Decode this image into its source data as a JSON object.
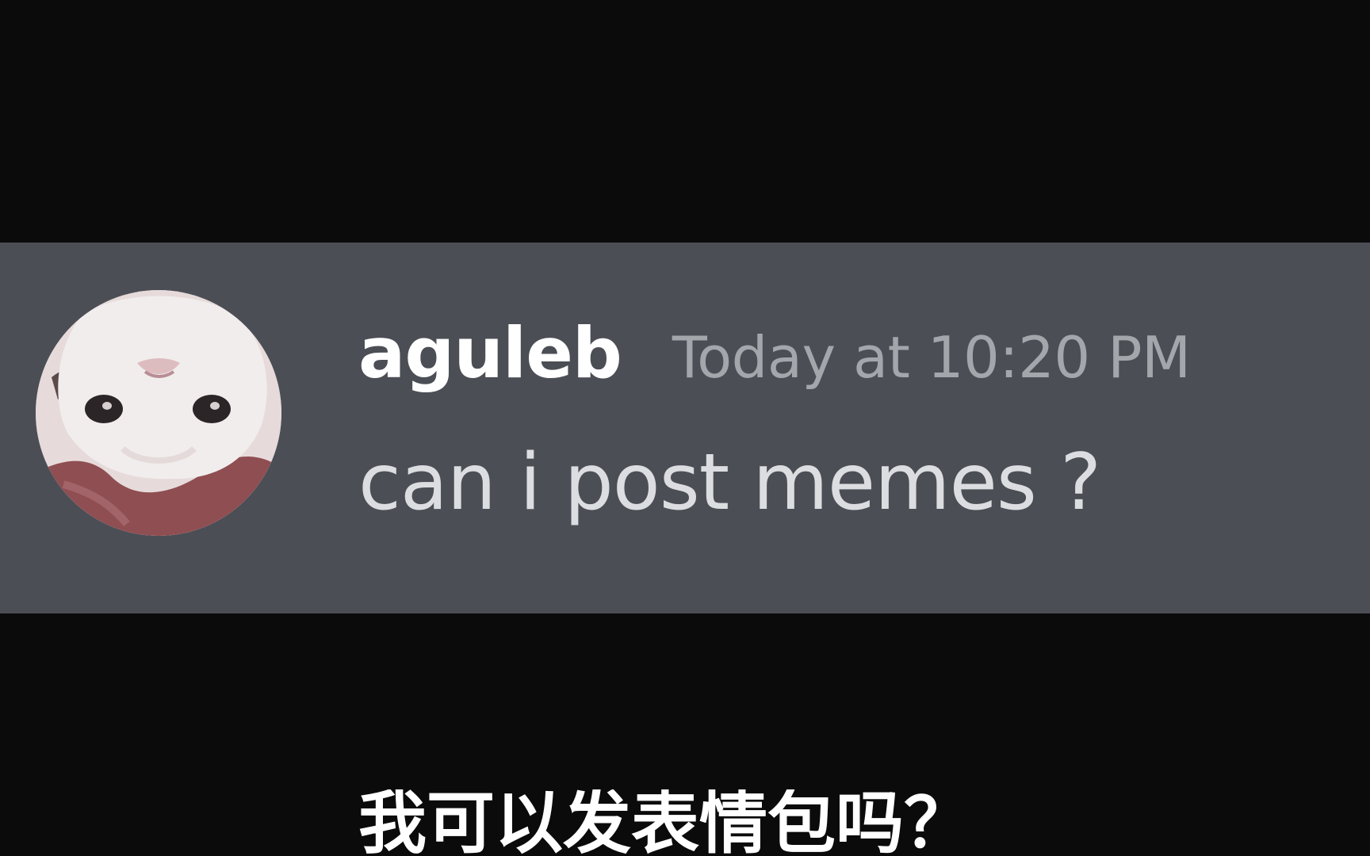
{
  "message": {
    "username": "aguleb",
    "timestamp": "Today at 10:20 PM",
    "text": "can i post memes ?",
    "avatar_icon": "cat-avatar-icon"
  },
  "subtitle": {
    "text": "我可以发表情包吗？"
  },
  "colors": {
    "background": "#0b0b0c",
    "message_band": "#4b4e55",
    "username": "#ffffff",
    "timestamp": "#a3a6ab",
    "message_text": "#dcdde0",
    "subtitle_text": "#ffffff"
  }
}
